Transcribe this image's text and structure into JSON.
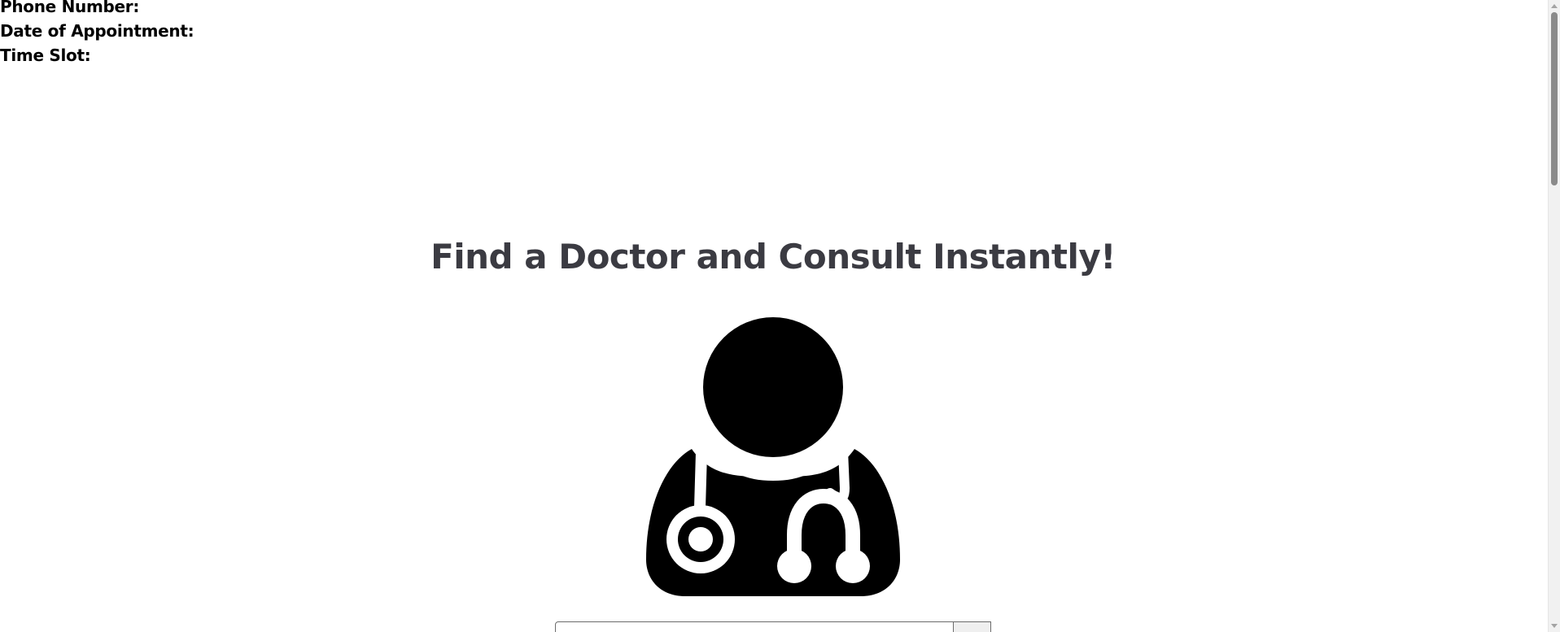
{
  "details": {
    "phone_label": "Phone Number:",
    "date_label": "Date of Appointment:",
    "time_label": "Time Slot:"
  },
  "main": {
    "heading": "Find a Doctor and Consult Instantly!",
    "illustration_icon": "doctor-icon",
    "search": {
      "value": "",
      "placeholder": ""
    }
  }
}
